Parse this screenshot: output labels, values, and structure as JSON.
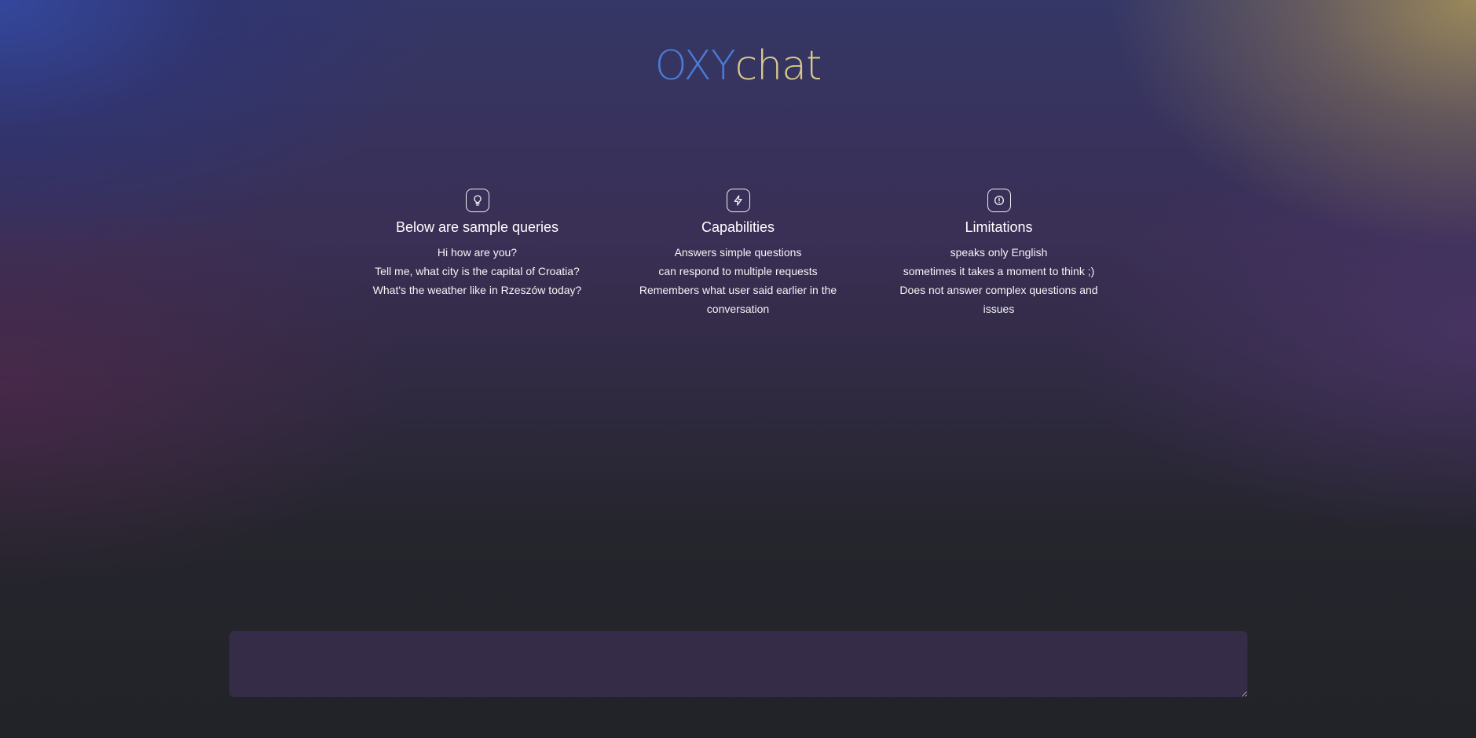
{
  "logo": {
    "part1": "OXY",
    "part2": "chat"
  },
  "columns": [
    {
      "icon": "lightbulb-icon",
      "title": "Below are sample queries",
      "items": [
        "Hi how are you?",
        "Tell me, what city is the capital of Croatia?",
        "What's the weather like in Rzeszów today?"
      ]
    },
    {
      "icon": "lightning-bolt-icon",
      "title": "Capabilities",
      "items": [
        "Answers simple questions",
        "can respond to multiple requests",
        "Remembers what user said earlier in the conversation"
      ]
    },
    {
      "icon": "alert-circle-icon",
      "title": "Limitations",
      "items": [
        "speaks only English",
        "sometimes it takes a moment to think ;)",
        "Does not answer complex questions and issues"
      ]
    }
  ],
  "chat_input": {
    "value": "",
    "placeholder": ""
  },
  "colors": {
    "logo_blue": "#4b7ad4",
    "logo_gold": "#d8c98a",
    "input_bg": "#352d47"
  }
}
